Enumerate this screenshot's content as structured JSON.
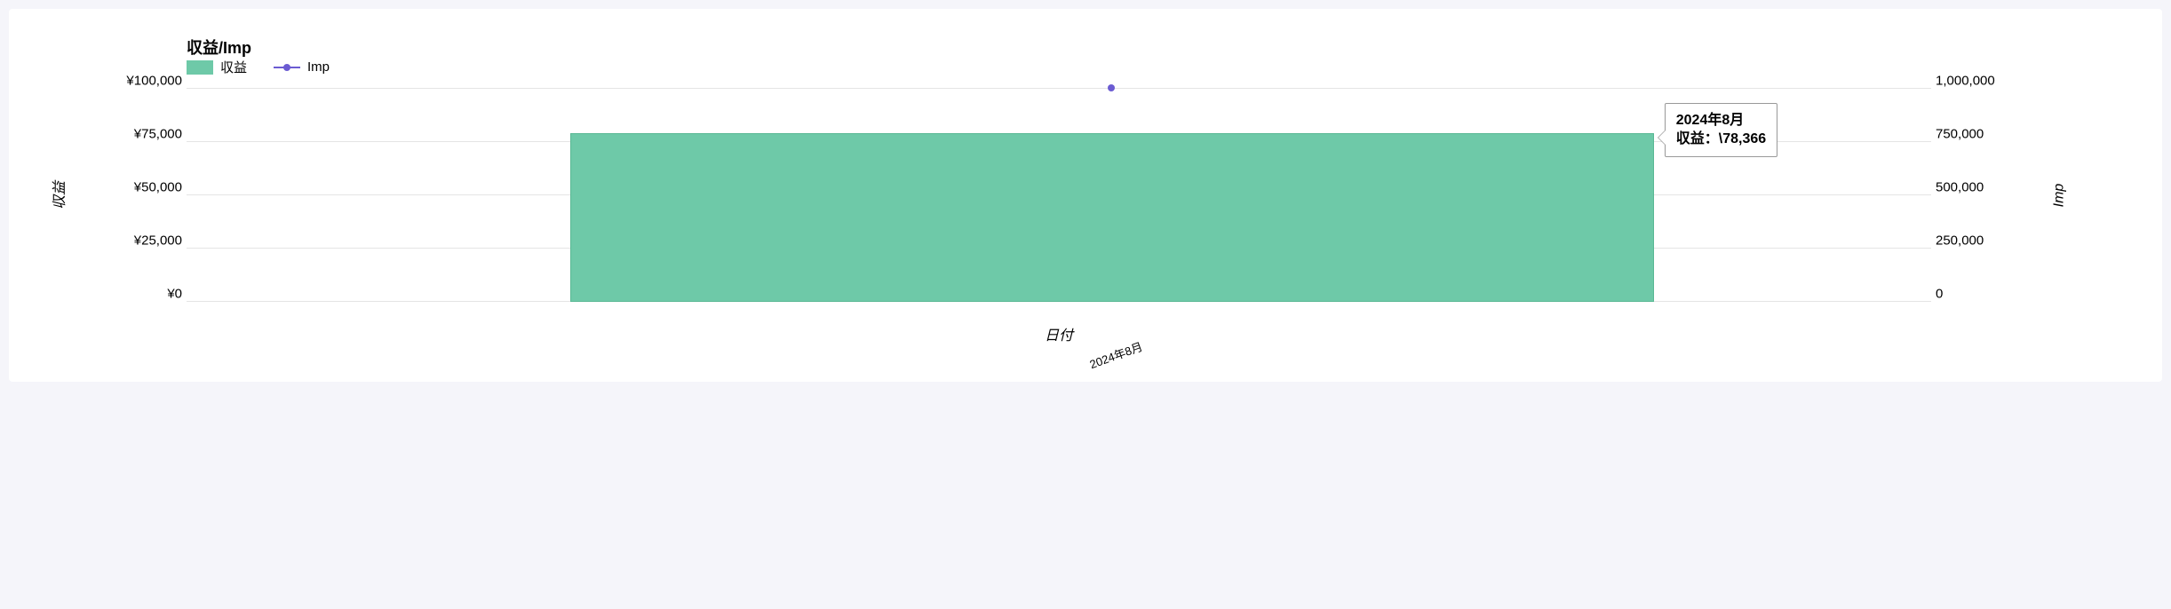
{
  "title": "収益/Imp",
  "legend": {
    "bar": "収益",
    "line": "Imp"
  },
  "axis": {
    "left_title": "収益",
    "right_title": "Imp",
    "x_title": "日付"
  },
  "left_ticks": [
    "¥0",
    "¥25,000",
    "¥50,000",
    "¥75,000",
    "¥100,000"
  ],
  "right_ticks": [
    "0",
    "250,000",
    "500,000",
    "750,000",
    "1,000,000"
  ],
  "tooltip": {
    "line1": "2024年8月",
    "line2_label": "収益：",
    "line2_value": "\\78,366"
  },
  "x_categories": [
    "2024年8月"
  ],
  "chart_data": {
    "type": "bar",
    "title": "収益/Imp",
    "xlabel": "日付",
    "ylabel": "収益",
    "y2label": "Imp",
    "categories": [
      "2024年8月"
    ],
    "ylim": [
      0,
      100000
    ],
    "y2lim": [
      0,
      1000000
    ],
    "series": [
      {
        "name": "収益",
        "type": "bar",
        "axis": "left",
        "values": [
          78366
        ]
      },
      {
        "name": "Imp",
        "type": "line",
        "axis": "right",
        "values": [
          970000
        ]
      }
    ],
    "left_ticks": [
      0,
      25000,
      50000,
      75000,
      100000
    ],
    "right_ticks": [
      0,
      250000,
      500000,
      750000,
      1000000
    ]
  }
}
